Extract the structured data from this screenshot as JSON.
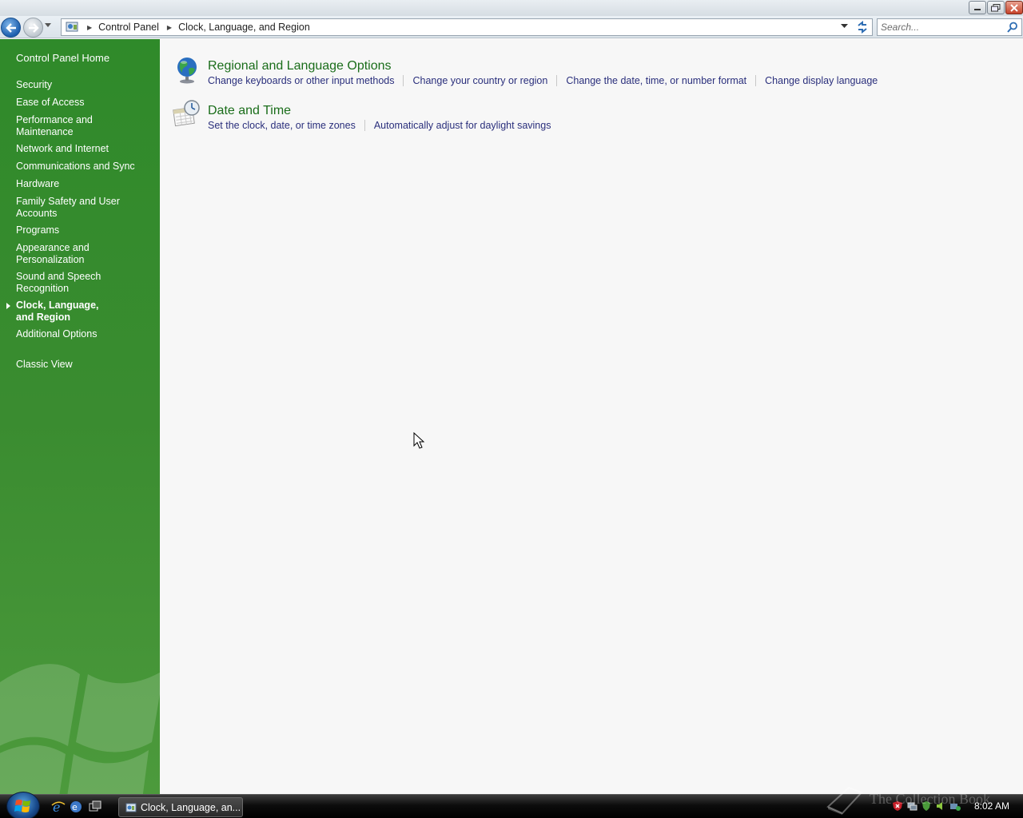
{
  "window": {
    "minimize_icon": "minimize-icon",
    "maximize_icon": "restore-icon",
    "close_icon": "close-icon"
  },
  "address_bar": {
    "breadcrumbs": [
      "Control Panel",
      "Clock, Language, and Region"
    ],
    "search_placeholder": "Search..."
  },
  "sidebar": {
    "home": "Control Panel Home",
    "items": [
      {
        "label": "Security",
        "active": false
      },
      {
        "label": "Ease of Access",
        "active": false
      },
      {
        "label": "Performance and Maintenance",
        "active": false
      },
      {
        "label": "Network and Internet",
        "active": false
      },
      {
        "label": "Communications and Sync",
        "active": false
      },
      {
        "label": "Hardware",
        "active": false
      },
      {
        "label": "Family Safety and User Accounts",
        "active": false
      },
      {
        "label": "Programs",
        "active": false
      },
      {
        "label": "Appearance and Personalization",
        "active": false
      },
      {
        "label": "Sound and Speech Recognition",
        "active": false
      },
      {
        "label": "Clock, Language, and Region",
        "active": true
      },
      {
        "label": "Additional Options",
        "active": false
      }
    ],
    "classic_view": "Classic View"
  },
  "main": {
    "categories": [
      {
        "title": "Regional and Language Options",
        "icon": "globe-icon",
        "tasks": [
          "Change keyboards or other input methods",
          "Change your country or region",
          "Change the date, time, or number format",
          "Change display language"
        ]
      },
      {
        "title": "Date and Time",
        "icon": "clock-calendar-icon",
        "tasks": [
          "Set the clock, date, or time zones",
          "Automatically adjust for daylight savings"
        ]
      }
    ]
  },
  "taskbar": {
    "window_button": "Clock, Language, an...",
    "clock": "8:02 AM"
  },
  "watermark_text": "The Collection Book",
  "colors": {
    "sidebar_green": "#3a8c30",
    "category_title_green": "#1a6d1a",
    "task_link": "#2a2f7c"
  }
}
